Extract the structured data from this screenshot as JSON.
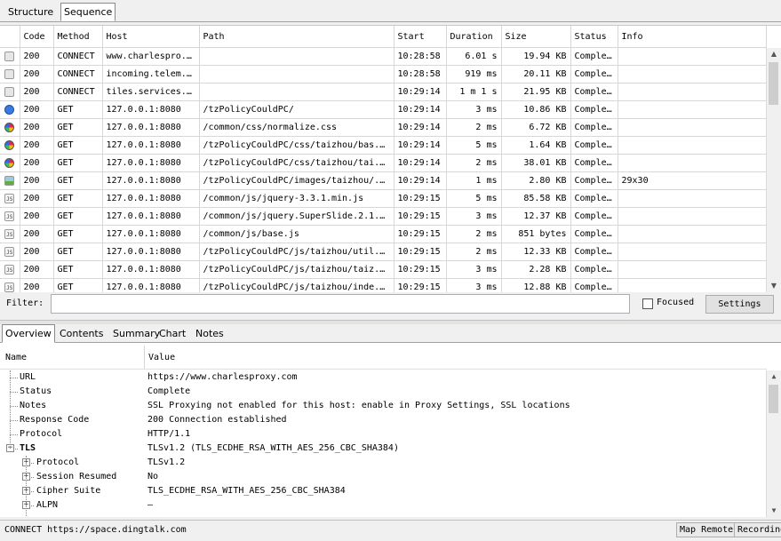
{
  "top_tabs": [
    "Structure",
    "Sequence"
  ],
  "table": {
    "columns": [
      "Code",
      "Method",
      "Host",
      "Path",
      "Start",
      "Duration",
      "Size",
      "Status",
      "Info"
    ],
    "rows": [
      {
        "icon": "lock-icon",
        "code": "200",
        "method": "CONNECT",
        "host": "www.charlespro...",
        "path": "",
        "start": "10:28:58",
        "duration": "6.01 s",
        "size": "19.94 KB",
        "status": "Complete",
        "info": ""
      },
      {
        "icon": "lock-icon",
        "code": "200",
        "method": "CONNECT",
        "host": "incoming.telem...",
        "path": "",
        "start": "10:28:58",
        "duration": "919 ms",
        "size": "20.11 KB",
        "status": "Complete",
        "info": ""
      },
      {
        "icon": "lock-icon",
        "code": "200",
        "method": "CONNECT",
        "host": "tiles.services...",
        "path": "",
        "start": "10:29:14",
        "duration": "1 m 1 s",
        "size": "21.95 KB",
        "status": "Complete",
        "info": ""
      },
      {
        "icon": "globe-icon",
        "code": "200",
        "method": "GET",
        "host": "127.0.0.1:8080",
        "path": "/tzPolicyCouldPC/",
        "start": "10:29:14",
        "duration": "3 ms",
        "size": "10.86 KB",
        "status": "Complete",
        "info": ""
      },
      {
        "icon": "css-icon",
        "code": "200",
        "method": "GET",
        "host": "127.0.0.1:8080",
        "path": "/common/css/normalize.css",
        "start": "10:29:14",
        "duration": "2 ms",
        "size": "6.72 KB",
        "status": "Complete",
        "info": ""
      },
      {
        "icon": "css-icon",
        "code": "200",
        "method": "GET",
        "host": "127.0.0.1:8080",
        "path": "/tzPolicyCouldPC/css/taizhou/bas...",
        "start": "10:29:14",
        "duration": "5 ms",
        "size": "1.64 KB",
        "status": "Complete",
        "info": ""
      },
      {
        "icon": "css-icon",
        "code": "200",
        "method": "GET",
        "host": "127.0.0.1:8080",
        "path": "/tzPolicyCouldPC/css/taizhou/tai...",
        "start": "10:29:14",
        "duration": "2 ms",
        "size": "38.01 KB",
        "status": "Complete",
        "info": ""
      },
      {
        "icon": "image-icon",
        "code": "200",
        "method": "GET",
        "host": "127.0.0.1:8080",
        "path": "/tzPolicyCouldPC/images/taizhou/...",
        "start": "10:29:14",
        "duration": "1 ms",
        "size": "2.80 KB",
        "status": "Complete",
        "info": "29x30"
      },
      {
        "icon": "js-icon",
        "code": "200",
        "method": "GET",
        "host": "127.0.0.1:8080",
        "path": "/common/js/jquery-3.3.1.min.js",
        "start": "10:29:15",
        "duration": "5 ms",
        "size": "85.58 KB",
        "status": "Complete",
        "info": ""
      },
      {
        "icon": "js-icon",
        "code": "200",
        "method": "GET",
        "host": "127.0.0.1:8080",
        "path": "/common/js/jquery.SuperSlide.2.1...",
        "start": "10:29:15",
        "duration": "3 ms",
        "size": "12.37 KB",
        "status": "Complete",
        "info": ""
      },
      {
        "icon": "js-icon",
        "code": "200",
        "method": "GET",
        "host": "127.0.0.1:8080",
        "path": "/common/js/base.js",
        "start": "10:29:15",
        "duration": "2 ms",
        "size": "851 bytes",
        "status": "Complete",
        "info": ""
      },
      {
        "icon": "js-icon",
        "code": "200",
        "method": "GET",
        "host": "127.0.0.1:8080",
        "path": "/tzPolicyCouldPC/js/taizhou/util...",
        "start": "10:29:15",
        "duration": "2 ms",
        "size": "12.33 KB",
        "status": "Complete",
        "info": ""
      },
      {
        "icon": "js-icon",
        "code": "200",
        "method": "GET",
        "host": "127.0.0.1:8080",
        "path": "/tzPolicyCouldPC/js/taizhou/taiz...",
        "start": "10:29:15",
        "duration": "3 ms",
        "size": "2.28 KB",
        "status": "Complete",
        "info": ""
      },
      {
        "icon": "js-icon",
        "code": "200",
        "method": "GET",
        "host": "127.0.0.1:8080",
        "path": "/tzPolicyCouldPC/js/taizhou/inde...",
        "start": "10:29:15",
        "duration": "3 ms",
        "size": "12.88 KB",
        "status": "Complete",
        "info": ""
      }
    ]
  },
  "filter": {
    "label": "Filter:",
    "value": "",
    "focused_label": "Focused",
    "focused_checked": false,
    "settings_label": "Settings"
  },
  "bottom_tabs": [
    "Overview",
    "Contents",
    "Summary",
    "Chart",
    "Notes"
  ],
  "overview": {
    "name_header": "Name",
    "value_header": "Value",
    "rows": [
      {
        "name": "URL",
        "value": "https://www.charlesproxy.com",
        "level": 0,
        "expander": ""
      },
      {
        "name": "Status",
        "value": "Complete",
        "level": 0,
        "expander": ""
      },
      {
        "name": "Notes",
        "value": "SSL Proxying not enabled for this host: enable in Proxy Settings, SSL locations",
        "level": 0,
        "expander": ""
      },
      {
        "name": "Response Code",
        "value": "200 Connection established",
        "level": 0,
        "expander": ""
      },
      {
        "name": "Protocol",
        "value": "HTTP/1.1",
        "level": 0,
        "expander": ""
      },
      {
        "name": "TLS",
        "value": "TLSv1.2 (TLS_ECDHE_RSA_WITH_AES_256_CBC_SHA384)",
        "level": 0,
        "expander": "−",
        "bold": true
      },
      {
        "name": "Protocol",
        "value": "TLSv1.2",
        "level": 1,
        "expander": "+"
      },
      {
        "name": "Session Resumed",
        "value": "No",
        "level": 1,
        "expander": "+"
      },
      {
        "name": "Cipher Suite",
        "value": "TLS_ECDHE_RSA_WITH_AES_256_CBC_SHA384",
        "level": 1,
        "expander": "+"
      },
      {
        "name": "ALPN",
        "value": "–",
        "level": 1,
        "expander": "+"
      }
    ]
  },
  "statusbar": {
    "text": "CONNECT https://space.dingtalk.com",
    "map_remote": "Map Remote",
    "recording": "Recording"
  }
}
